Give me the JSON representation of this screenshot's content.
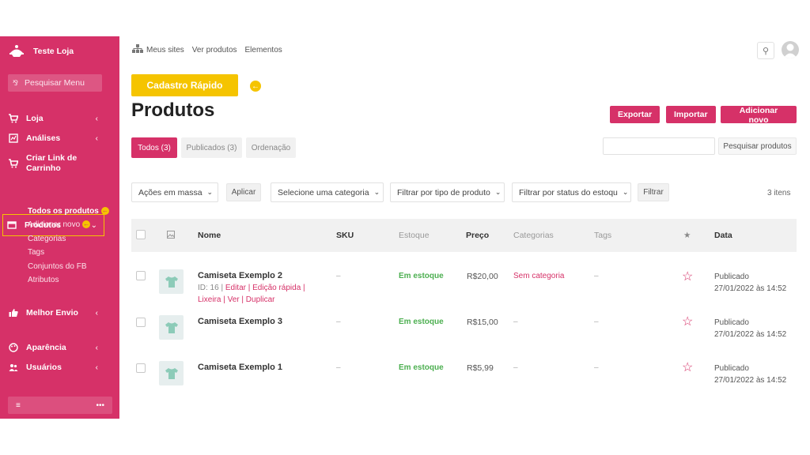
{
  "sidebar": {
    "brand": "Teste Loja",
    "search_placeholder": "Pesquisar Menu",
    "items": [
      {
        "label": "Loja",
        "icon": "cart-icon"
      },
      {
        "label": "Análises",
        "icon": "chart-icon"
      },
      {
        "label": "Criar Link de Carrinho",
        "icon": "cart-icon"
      },
      {
        "label": "Produtos",
        "icon": "box-icon"
      },
      {
        "label": "Melhor Envio",
        "icon": "thumbs-up-icon"
      },
      {
        "label": "Aparência",
        "icon": "palette-icon"
      },
      {
        "label": "Usuários",
        "icon": "users-icon"
      }
    ],
    "submenu": [
      {
        "label": "Todos os produtos"
      },
      {
        "label": "Adicionar novo"
      },
      {
        "label": "Categorias"
      },
      {
        "label": "Tags"
      },
      {
        "label": "Conjuntos do FB"
      },
      {
        "label": "Atributos"
      }
    ],
    "footer_more": "•••"
  },
  "topbar": {
    "links": [
      "Meus sites",
      "Ver produtos",
      "Elementos"
    ]
  },
  "quick_add_label": "Cadastro Rápido",
  "page_title": "Produtos",
  "page_actions": {
    "export": "Exportar",
    "import": "Importar",
    "add_new": "Adicionar novo"
  },
  "tabs": [
    {
      "label": "Todos (3)"
    },
    {
      "label": "Publicados (3)"
    },
    {
      "label": "Ordenação"
    }
  ],
  "search_button": "Pesquisar produtos",
  "filters": {
    "bulk_actions": "Ações em massa",
    "apply": "Aplicar",
    "category": "Selecione uma categoria",
    "product_type": "Filtrar por tipo de produto",
    "stock_status": "Filtrar por status do estoqu",
    "filter": "Filtrar",
    "items_count": "3 itens"
  },
  "table": {
    "headers": {
      "name": "Nome",
      "sku": "SKU",
      "stock": "Estoque",
      "price": "Preço",
      "categories": "Categorias",
      "tags": "Tags",
      "featured": "★",
      "date": "Data"
    },
    "rows": [
      {
        "name": "Camiseta Exemplo 2",
        "sku": "–",
        "stock": "Em estoque",
        "price": "R$20,00",
        "category": "Sem categoria",
        "tags": "–",
        "status": "Publicado",
        "date": "27/01/2022 às 14:52",
        "actions": {
          "id": "ID: 16 |",
          "edit": "Editar",
          "quick_edit": "Edição rápida",
          "trash": "Lixeira",
          "view": "Ver",
          "duplicate": "Duplicar"
        }
      },
      {
        "name": "Camiseta Exemplo 3",
        "sku": "–",
        "stock": "Em estoque",
        "price": "R$15,00",
        "category": "–",
        "tags": "–",
        "status": "Publicado",
        "date": "27/01/2022 às 14:52"
      },
      {
        "name": "Camiseta Exemplo 1",
        "sku": "–",
        "stock": "Em estoque",
        "price": "R$5,99",
        "category": "–",
        "tags": "–",
        "status": "Publicado",
        "date": "27/01/2022 às 14:52"
      }
    ]
  },
  "colors": {
    "brand": "#d63168",
    "highlight": "#f5c400",
    "in_stock": "#4caf50"
  }
}
